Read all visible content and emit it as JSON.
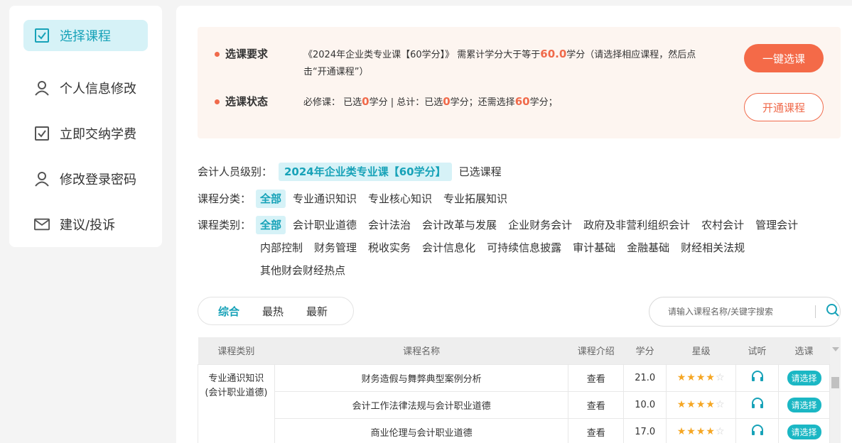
{
  "sidebar": {
    "items": [
      {
        "label": "选择课程",
        "icon": "checkbox-icon"
      },
      {
        "label": "个人信息修改",
        "icon": "user-icon"
      },
      {
        "label": "立即交纳学费",
        "icon": "checkbox-icon"
      },
      {
        "label": "修改登录密码",
        "icon": "user-icon"
      },
      {
        "label": "建议/投诉",
        "icon": "mail-icon"
      }
    ]
  },
  "requirement": {
    "title1": "选课要求",
    "text1_a": "《2024年企业类专业课【60学分】》 需累计学分大于等于",
    "text1_credits": "60.0",
    "text1_b": "学分（请选择相应课程，然后点",
    "text1_c": "击“开通课程”）",
    "title2": "选课状态",
    "text2_a": "必修课：  已选",
    "text2_sel": "0",
    "text2_b": "学分 | 总计：已选",
    "text2_total": "0",
    "text2_c": "学分；还需选择",
    "text2_need": "60",
    "text2_d": "学分；",
    "btn_one_click": "一键选课",
    "btn_open": "开通课程"
  },
  "filters": {
    "level_label": "会计人员级别：",
    "level_value": "2024年企业类专业课【60学分】",
    "level_link": "已选课程",
    "category_label": "课程分类：",
    "categories": [
      "全部",
      "专业通识知识",
      "专业核心知识",
      "专业拓展知识"
    ],
    "type_label": "课程类别：",
    "types": [
      "全部",
      "会计职业道德",
      "会计法治",
      "会计改革与发展",
      "企业财务会计",
      "政府及非营利组织会计",
      "农村会计",
      "管理会计",
      "内部控制",
      "财务管理",
      "税收实务",
      "会计信息化",
      "可持续信息披露",
      "审计基础",
      "金融基础",
      "财经相关法规",
      "其他财会财经热点"
    ]
  },
  "sort": {
    "options": [
      "综合",
      "最热",
      "最新"
    ]
  },
  "search": {
    "placeholder": "请输入课程名称/关键字搜索"
  },
  "table": {
    "headers": [
      "课程类别",
      "课程名称",
      "课程介绍",
      "学分",
      "星级",
      "试听",
      "选课"
    ],
    "category": "专业通识知识\n(会计职业道德)",
    "category_line1": "专业通识知识",
    "category_line2": "(会计职业道德)",
    "rows": [
      {
        "name": "财务造假与舞弊典型案例分析",
        "intro": "查看",
        "credit": "21.0",
        "rating": 4,
        "pick": "请选择"
      },
      {
        "name": "会计工作法律法规与会计职业道德",
        "intro": "查看",
        "credit": "10.0",
        "rating": 4,
        "pick": "请选择"
      },
      {
        "name": "商业伦理与会计职业道德",
        "intro": "查看",
        "credit": "17.0",
        "rating": 4,
        "pick": "请选择"
      }
    ]
  },
  "colors": {
    "accent": "#17a2b8",
    "highlight": "#f06a4b"
  }
}
